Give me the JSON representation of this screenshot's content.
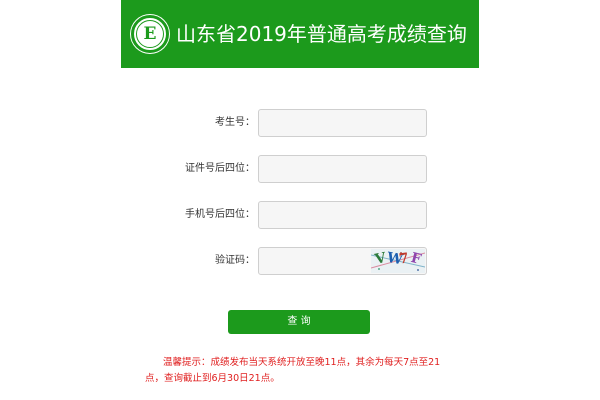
{
  "header": {
    "title": "山东省2019年普通高考成绩查询",
    "logo_letter": "E",
    "accent_color": "#1c9a1c"
  },
  "form": {
    "exam_number_label": "考生号：",
    "exam_number_value": "",
    "id_last4_label": "证件号后四位：",
    "id_last4_value": "",
    "phone_last4_label": "手机号后四位：",
    "phone_last4_value": "",
    "captcha_label": "验证码：",
    "captcha_value": "",
    "captcha_text": "VW7F"
  },
  "submit_label": "查 询",
  "notice": "温馨提示：成绩发布当天系统开放至晚11点，其余为每天7点至21点，查询截止到6月30日21点。",
  "notice_color": "#e02020"
}
